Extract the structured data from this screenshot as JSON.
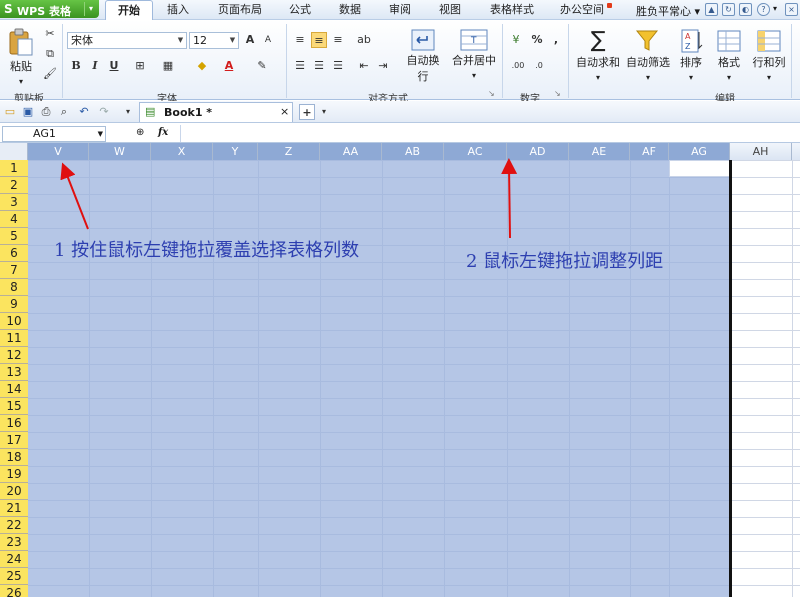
{
  "app": {
    "name": "WPS 表格",
    "logo_char": "S"
  },
  "menu": {
    "tabs": [
      "开始",
      "插入",
      "页面布局",
      "公式",
      "数据",
      "审阅",
      "视图",
      "表格样式",
      "办公空间"
    ],
    "active_tab": "开始",
    "user": "胜负平常心"
  },
  "ribbon": {
    "paste": "粘贴",
    "font_name": "宋体",
    "font_size": "12",
    "groups": [
      "剪贴板",
      "字体",
      "对齐方式",
      "数字",
      "编辑"
    ],
    "bold": "B",
    "italic": "I",
    "underline": "U",
    "grow_font": "A",
    "shrink_font": "A",
    "font_color": "A",
    "percent": "%",
    "comma": ",",
    "dec_inc": ".00",
    "dec_dec": ".0",
    "wrap_text": "自动换行",
    "merge_center": "合并居中",
    "autosum": "自动求和",
    "autofilter": "自动筛选",
    "sort": "排序",
    "format": "格式",
    "rows_cols": "行和列"
  },
  "document": {
    "tab_title": "Book1 *",
    "close_glyph": "×",
    "new_glyph": "+"
  },
  "formula_bar": {
    "cell_ref": "AG1",
    "fx": "fx"
  },
  "columns": [
    "V",
    "W",
    "X",
    "Y",
    "Z",
    "AA",
    "AB",
    "AC",
    "AD",
    "AE",
    "AF",
    "AG",
    "AH"
  ],
  "rows": [
    "1",
    "2",
    "3",
    "4",
    "5",
    "6",
    "7",
    "8",
    "9",
    "10",
    "11",
    "12",
    "13",
    "14",
    "15",
    "16",
    "17",
    "18",
    "19",
    "20",
    "21",
    "22",
    "23",
    "24",
    "25",
    "26"
  ],
  "annotations": {
    "note1": "1 按住鼠标左键拖拉覆盖选择表格列数",
    "note2": "2 鼠标左键拖拉调整列距"
  },
  "colors": {
    "selection": "#98b0dc",
    "row_header": "#fbe45f",
    "annotation": "#2d3fb0",
    "arrow": "#e01010",
    "wps_green": "#4aa82c"
  }
}
